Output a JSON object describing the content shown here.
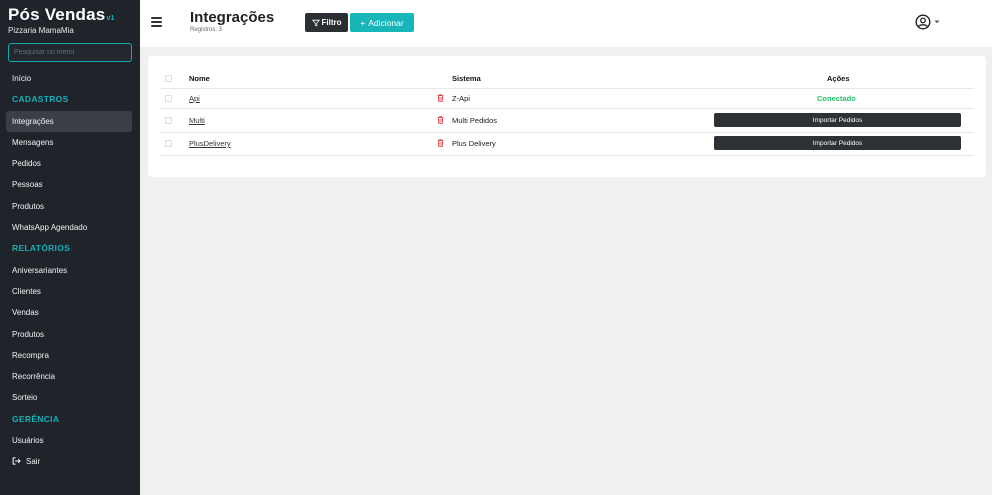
{
  "sidebar": {
    "brand": "Pós Vendas",
    "version": "v1",
    "company": "Pizzaria MamaMia",
    "search_placeholder": "Pesquisar no menu",
    "home": "Início",
    "sections": {
      "cadastros": "CADASTROS",
      "relatorios": "RELATÓRIOS",
      "gerencia": "GERÊNCIA"
    },
    "cadastros_items": [
      "Integrações",
      "Mensagens",
      "Pedidos",
      "Pessoas",
      "Produtos",
      "WhatsApp Agendado"
    ],
    "relatorios_items": [
      "Aniversariantes",
      "Clientes",
      "Vendas",
      "Produtos",
      "Recompra",
      "Recorrência",
      "Sorteio"
    ],
    "gerencia_items": [
      "Usuários"
    ],
    "logout": "Sair"
  },
  "header": {
    "title": "Integrações",
    "subtitle": "Registros: 3",
    "filter_label": "Filtro",
    "add_label": "Adicionar"
  },
  "table": {
    "columns": [
      "Nome",
      "Sistema",
      "Ações"
    ],
    "rows": [
      {
        "name": "Api",
        "system": "Z-Api",
        "action": "Conectado"
      },
      {
        "name": "Multi",
        "system": "Multi Pedidos",
        "action": "Importar Pedidos"
      },
      {
        "name": "PlusDelivery",
        "system": "Plus Delivery",
        "action": "Importar Pedidos"
      }
    ]
  },
  "colors": {
    "sidebar_bg": "#1f232a",
    "accent": "#19b6b9",
    "success": "#1fc46a",
    "danger": "#e0323a"
  }
}
